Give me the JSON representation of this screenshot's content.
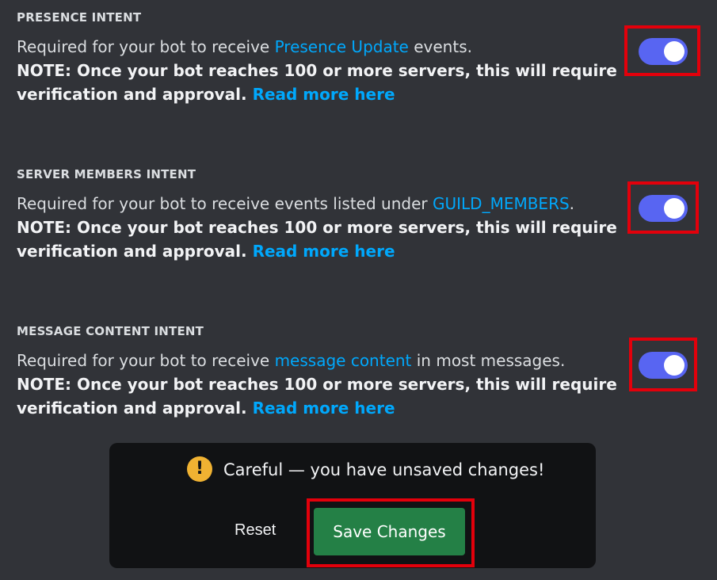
{
  "intents": [
    {
      "title": "PRESENCE INTENT",
      "desc_prefix": "Required for your bot to receive ",
      "desc_link": "Presence Update",
      "desc_suffix": " events.",
      "note": "NOTE: Once your bot reaches 100 or more servers, this will require verification and approval. ",
      "note_link": "Read more here",
      "enabled": true
    },
    {
      "title": "SERVER MEMBERS INTENT",
      "desc_prefix": "Required for your bot to receive events listed under ",
      "desc_link": "GUILD_MEMBERS",
      "desc_suffix": ".",
      "note": "NOTE: Once your bot reaches 100 or more servers, this will require verification and approval. ",
      "note_link": "Read more here",
      "enabled": true
    },
    {
      "title": "MESSAGE CONTENT INTENT",
      "desc_prefix": "Required for your bot to receive ",
      "desc_link": "message content",
      "desc_suffix": " in most messages.",
      "note": "NOTE: Once your bot reaches 100 or more servers, this will require verification and approval. ",
      "note_link": "Read more here",
      "enabled": true
    }
  ],
  "notice": {
    "icon": "warning-icon",
    "icon_glyph": "!",
    "message": "Careful — you have unsaved changes!",
    "reset_label": "Reset",
    "save_label": "Save Changes"
  },
  "colors": {
    "background": "#313338",
    "toggle_on": "#5865f2",
    "link": "#00a8fc",
    "save_button": "#248046",
    "warning": "#f0b232",
    "highlight": "#e3000b"
  }
}
